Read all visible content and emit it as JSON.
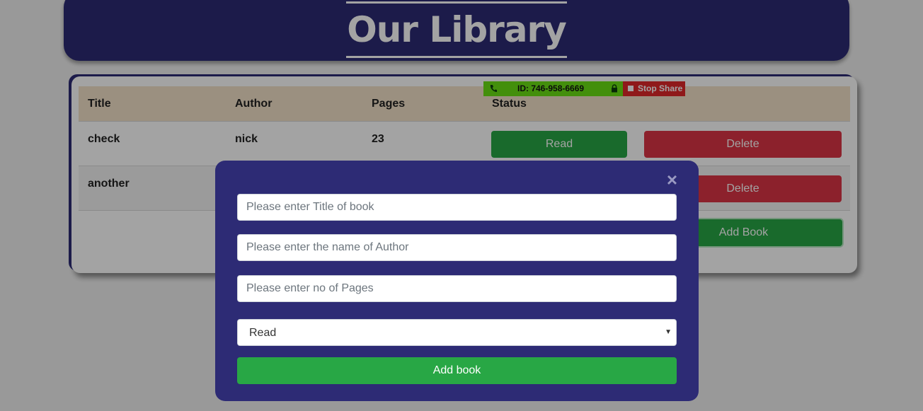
{
  "header": {
    "title": "Our Library"
  },
  "table": {
    "columns": [
      "Title",
      "Author",
      "Pages",
      "Status"
    ],
    "rows": [
      {
        "title": "check",
        "author": "nick",
        "pages": "23",
        "status_button": "Read",
        "delete_button": "Delete"
      },
      {
        "title": "another",
        "author": "",
        "pages": "",
        "status_button": "",
        "delete_button": "Delete"
      }
    ],
    "add_button": "Add Book"
  },
  "share_banner": {
    "id_text": "ID: 746-958-6669",
    "stop_label": "Stop Share"
  },
  "modal": {
    "close_glyph": "×",
    "title_placeholder": "Please enter Title of book",
    "author_placeholder": "Please enter the name of Author",
    "pages_placeholder": "Please enter no of Pages",
    "status_selected": "Read",
    "submit_label": "Add book"
  },
  "colors": {
    "header_bg": "#2d2b75",
    "table_head_bg": "#f3e2c9",
    "read_green": "#28a745",
    "delete_red": "#dc3545",
    "share_green": "#6ae014",
    "share_red": "#e0282a"
  }
}
